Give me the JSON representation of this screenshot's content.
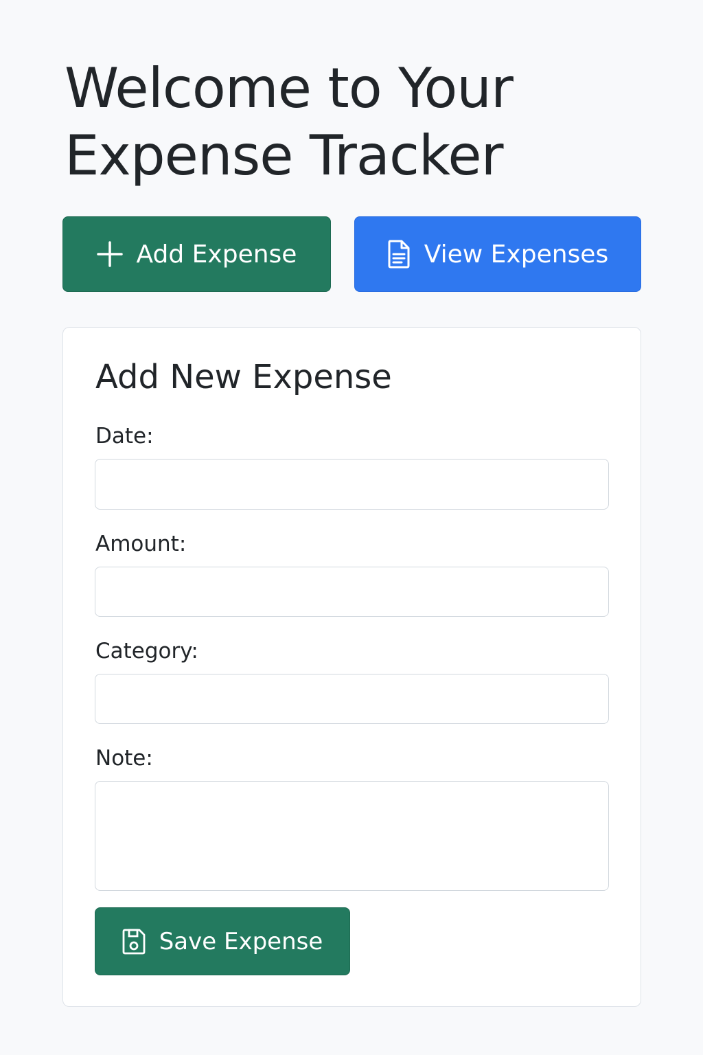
{
  "page": {
    "title": "Welcome to Your Expense Tracker"
  },
  "actions": {
    "add_label": "Add Expense",
    "add_icon": "plus-icon",
    "view_label": "View Expenses",
    "view_icon": "document-icon"
  },
  "form": {
    "title": "Add New Expense",
    "fields": {
      "date": {
        "label": "Date:",
        "value": "",
        "placeholder": ""
      },
      "amount": {
        "label": "Amount:",
        "value": "",
        "placeholder": ""
      },
      "category": {
        "label": "Category:",
        "value": "",
        "placeholder": ""
      },
      "note": {
        "label": "Note:",
        "value": "",
        "placeholder": ""
      }
    },
    "save_label": "Save Expense",
    "save_icon": "floppy-disk-icon"
  },
  "colors": {
    "background": "#f8f9fb",
    "primary_green": "#237a5f",
    "primary_blue": "#2f78f0",
    "text": "#212529",
    "border": "#d2d8de"
  }
}
